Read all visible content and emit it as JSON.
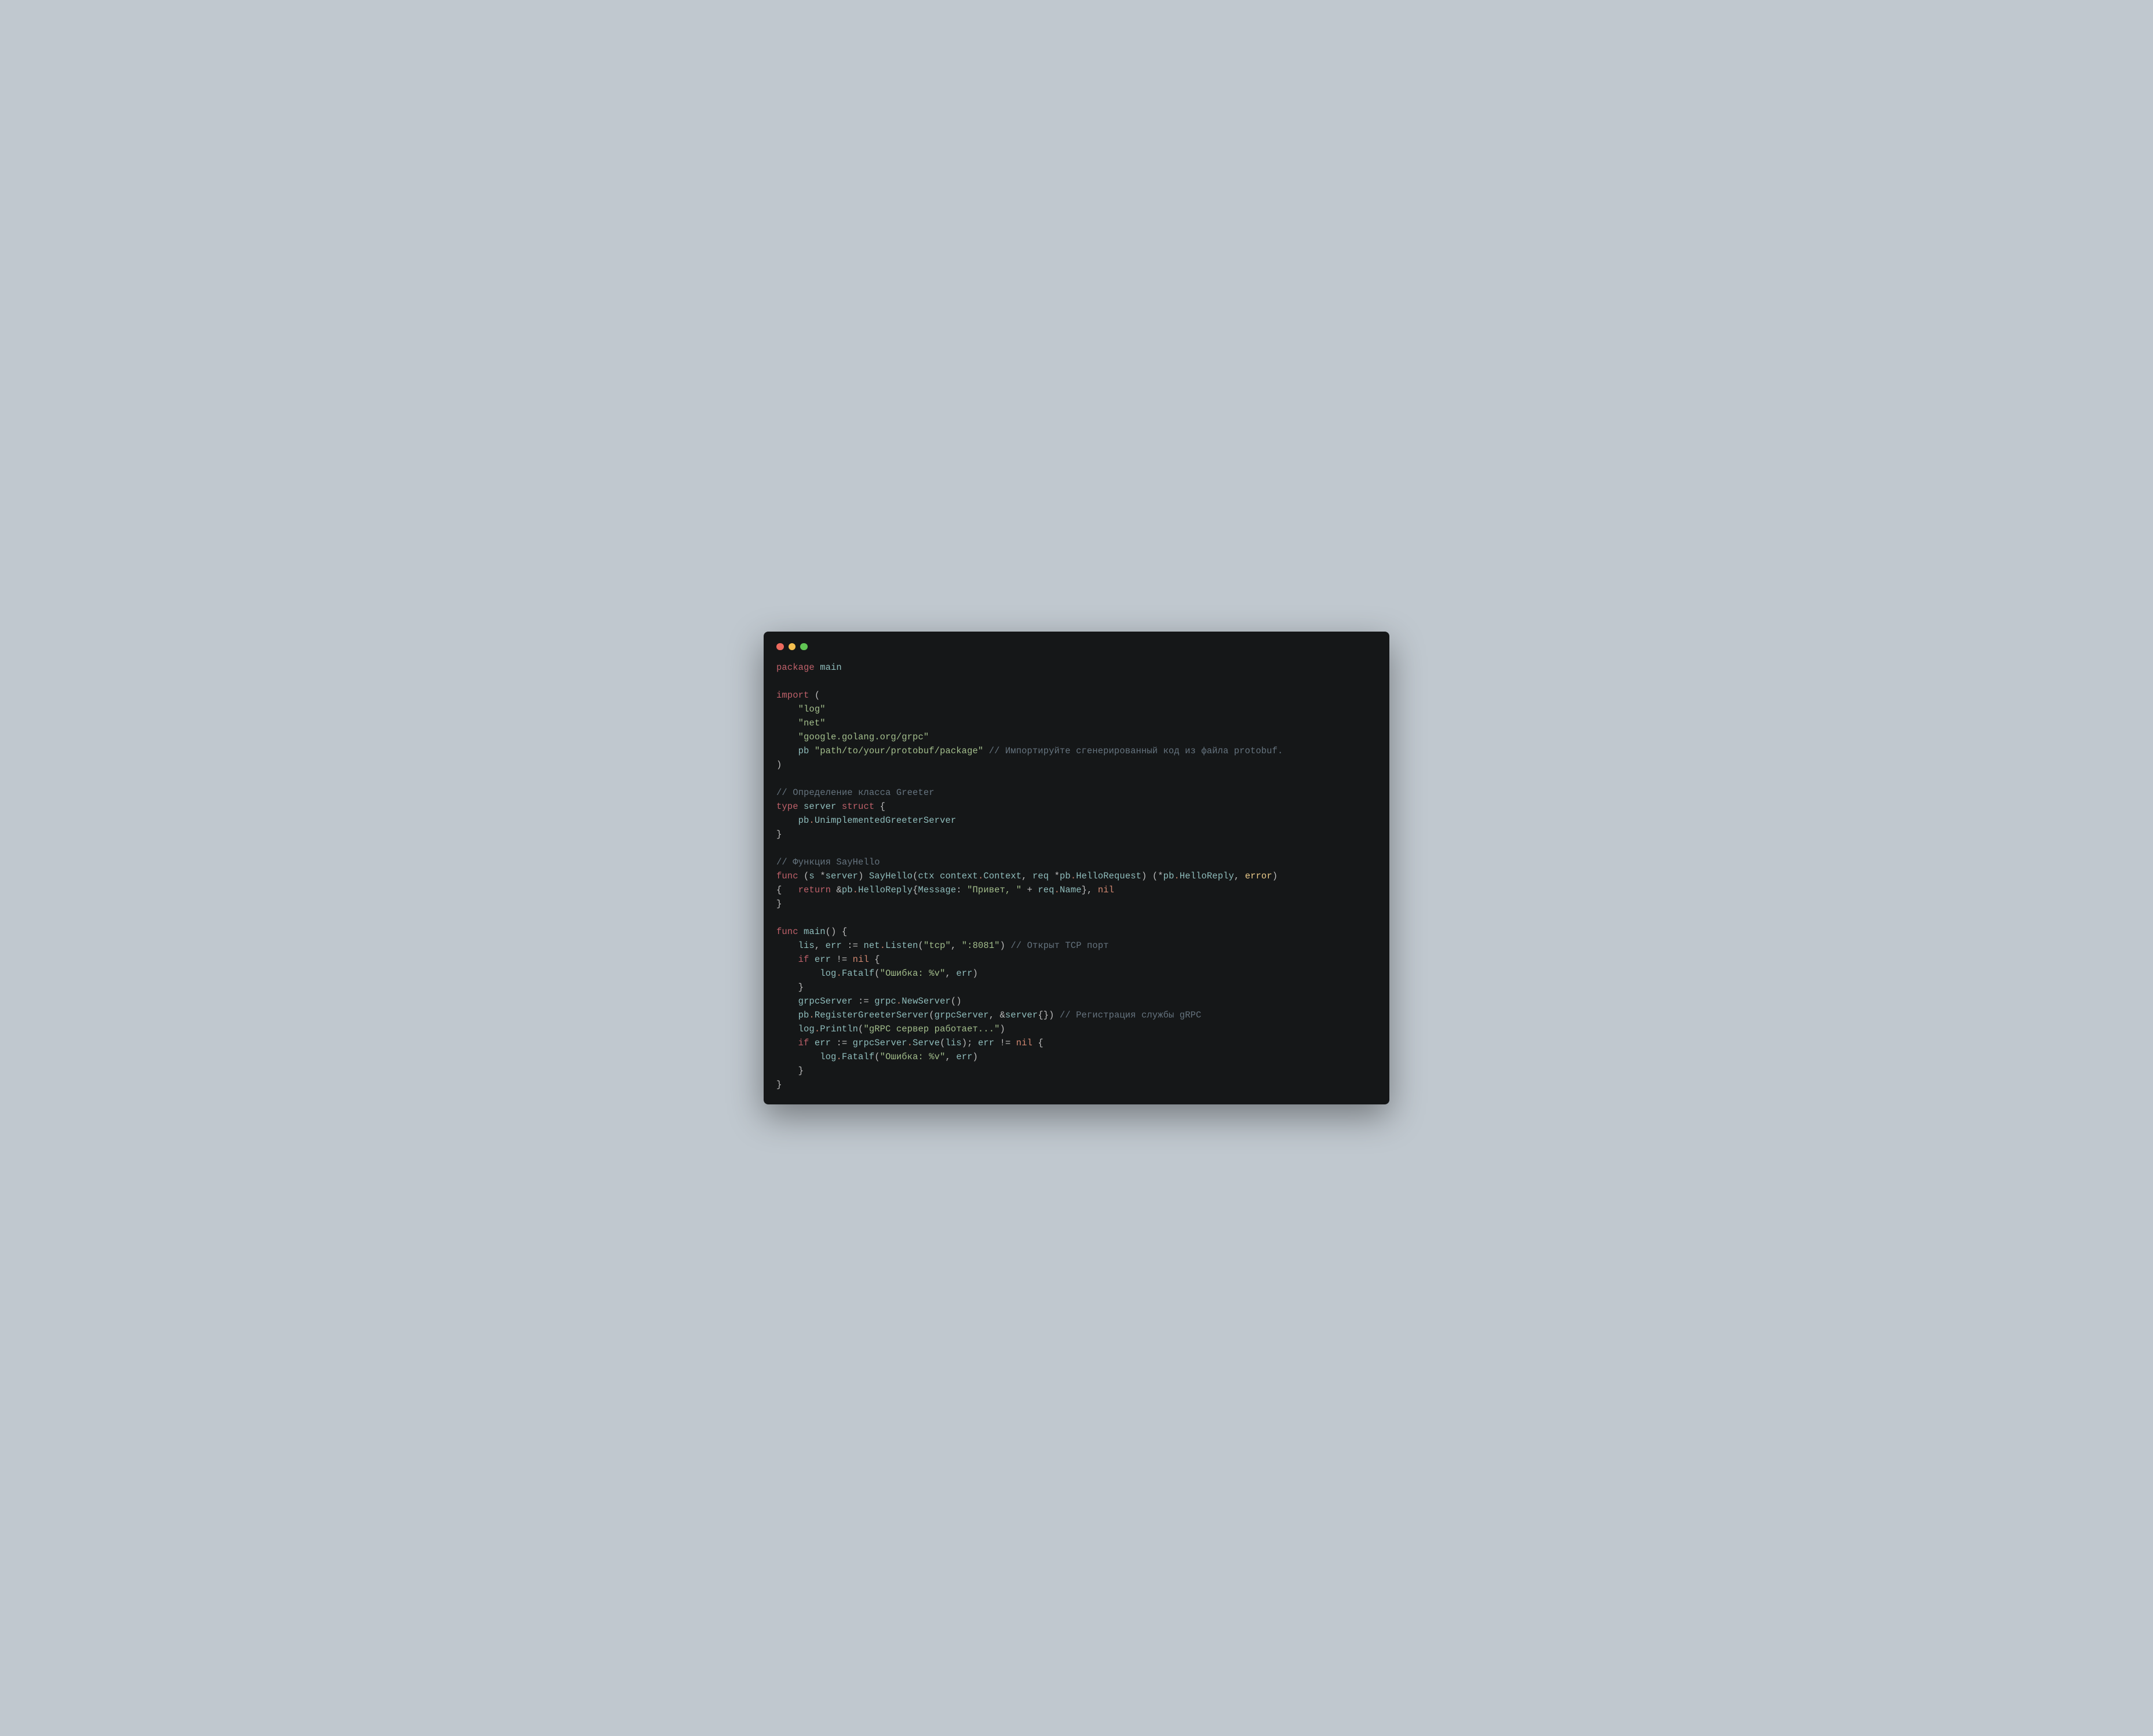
{
  "traffic_lights": {
    "red": "#ec6a5e",
    "yellow": "#f4bf4f",
    "green": "#61c554"
  },
  "code": {
    "l1_package": "package",
    "l1_main": "main",
    "l3_import": "import",
    "l3_lp": "(",
    "l4_log": "\"log\"",
    "l5_net": "\"net\"",
    "l6_grpc": "\"google.golang.org/grpc\"",
    "l7_pb": "pb",
    "l7_path": "\"path/to/your/protobuf/package\"",
    "l7_comment": "// Импортируйте сгенерированный код из файла protobuf.",
    "l8_rp": ")",
    "l10_comment": "// Определение класса Greeter",
    "l11_type": "type",
    "l11_server": "server",
    "l11_struct": "struct",
    "l11_lb": "{",
    "l12_pb": "pb",
    "l12_dot": ".",
    "l12_unimpl": "UnimplementedGreeterServer",
    "l13_rb": "}",
    "l15_comment": "// Функция SayHello",
    "l16_func": "func",
    "l16_recv_lp": "(",
    "l16_s": "s",
    "l16_star": "*",
    "l16_server": "server",
    "l16_recv_rp": ")",
    "l16_sayhello": "SayHello",
    "l16_args_lp": "(",
    "l16_ctx": "ctx",
    "l16_context1": "context",
    "l16_dot1": ".",
    "l16_context2": "Context",
    "l16_comma1": ",",
    "l16_req": "req",
    "l16_star2": "*",
    "l16_pb": "pb",
    "l16_dot2": ".",
    "l16_helloreq": "HelloRequest",
    "l16_args_rp": ")",
    "l16_ret_lp": "(",
    "l16_star3": "*",
    "l16_pb2": "pb",
    "l16_dot3": ".",
    "l16_helloreply": "HelloReply",
    "l16_comma2": ",",
    "l16_error": "error",
    "l16_ret_rp": ")",
    "l17_lb": "{",
    "l17_return": "return",
    "l17_amp": "&",
    "l17_pb": "pb",
    "l17_dot": ".",
    "l17_helloreply": "HelloReply",
    "l17_lb2": "{",
    "l17_message": "Message",
    "l17_colon": ":",
    "l17_str": "\"Привет, \"",
    "l17_plus": "+",
    "l17_req": "req",
    "l17_dot2": ".",
    "l17_name": "Name",
    "l17_rb2": "}",
    "l17_comma": ",",
    "l17_nil": "nil",
    "l18_rb": "}",
    "l20_func": "func",
    "l20_main": "main",
    "l20_lp": "(",
    "l20_rp": ")",
    "l20_lb": "{",
    "l21_lis": "lis",
    "l21_comma": ",",
    "l21_err": "err",
    "l21_assign": ":=",
    "l21_net": "net",
    "l21_dot": ".",
    "l21_listen": "Listen",
    "l21_lp": "(",
    "l21_tcp": "\"tcp\"",
    "l21_comma2": ",",
    "l21_port": "\":8081\"",
    "l21_rp": ")",
    "l21_com": "// Открыт TCP порт",
    "l22_if": "if",
    "l22_err": "err",
    "l22_neq": "!=",
    "l22_nil": "nil",
    "l22_lb": "{",
    "l23_log": "log",
    "l23_dot": ".",
    "l23_fatalf": "Fatalf",
    "l23_lp": "(",
    "l23_str": "\"Ошибка: %v\"",
    "l23_comma": ",",
    "l23_err": "err",
    "l23_rp": ")",
    "l24_rb": "}",
    "l25_grpcserver": "grpcServer",
    "l25_assign": ":=",
    "l25_grpc": "grpc",
    "l25_dot": ".",
    "l25_newserver": "NewServer",
    "l25_lp": "(",
    "l25_rp": ")",
    "l26_pb": "pb",
    "l26_dot": ".",
    "l26_register": "RegisterGreeterServer",
    "l26_lp": "(",
    "l26_grpcserver": "grpcServer",
    "l26_comma": ",",
    "l26_amp": "&",
    "l26_server": "server",
    "l26_lb": "{",
    "l26_rb": "}",
    "l26_rp": ")",
    "l26_com": "// Регистрация службы gRPC",
    "l27_log": "log",
    "l27_dot": ".",
    "l27_println": "Println",
    "l27_lp": "(",
    "l27_str": "\"gRPC сервер работает...\"",
    "l27_rp": ")",
    "l28_if": "if",
    "l28_err": "err",
    "l28_assign": ":=",
    "l28_grpcserver": "grpcServer",
    "l28_dot": ".",
    "l28_serve": "Serve",
    "l28_lp": "(",
    "l28_lis": "lis",
    "l28_rp": ")",
    "l28_semi": ";",
    "l28_err2": "err",
    "l28_neq": "!=",
    "l28_nil": "nil",
    "l28_lb": "{",
    "l29_log": "log",
    "l29_dot": ".",
    "l29_fatalf": "Fatalf",
    "l29_lp": "(",
    "l29_str": "\"Ошибка: %v\"",
    "l29_comma": ",",
    "l29_err": "err",
    "l29_rp": ")",
    "l30_rb": "}",
    "l31_rb": "}"
  }
}
